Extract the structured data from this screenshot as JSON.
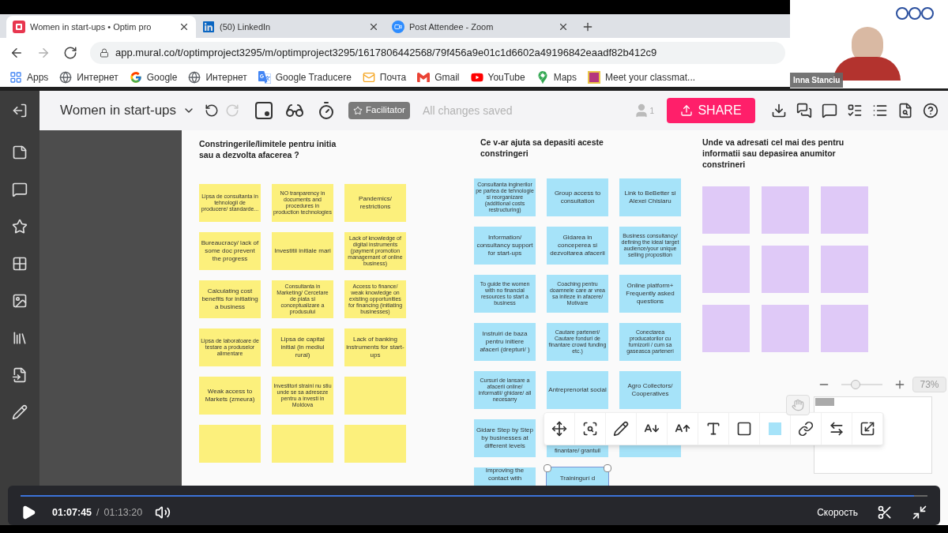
{
  "browser": {
    "tabs": [
      {
        "title": "Women in start-ups • Optim pro",
        "kind": "mural",
        "selected": true
      },
      {
        "title": "(50) LinkedIn",
        "kind": "linkedin",
        "selected": false
      },
      {
        "title": "Post Attendee - Zoom",
        "kind": "zoom",
        "selected": false
      }
    ],
    "nav": [
      {
        "kind": "back",
        "disabled": false
      },
      {
        "kind": "forward",
        "disabled": true
      },
      {
        "kind": "reload",
        "disabled": false
      }
    ],
    "url": "app.mural.co/t/optimproject3295/m/optimproject3295/1617806442568/79f456a9e01c1d6602a49196842eaadf82b412c9",
    "bookmarks": [
      {
        "label": "Apps",
        "kind": "apps"
      },
      {
        "label": "Интернет",
        "kind": "globe"
      },
      {
        "label": "Google",
        "kind": "google"
      },
      {
        "label": "Интернет",
        "kind": "globe"
      },
      {
        "label": "Google Traducere",
        "kind": "translate"
      },
      {
        "label": "Почта",
        "kind": "mail"
      },
      {
        "label": "Gmail",
        "kind": "gmail"
      },
      {
        "label": "YouTube",
        "kind": "youtube"
      },
      {
        "label": "Maps",
        "kind": "maps"
      },
      {
        "label": "Meet your classmat...",
        "kind": "square"
      }
    ]
  },
  "webcam": {
    "name": "Inna Stanciu"
  },
  "mural": {
    "title": "Women in start-ups",
    "history": [
      {
        "kind": "undo",
        "disabled": false
      },
      {
        "kind": "redo",
        "disabled": true
      }
    ],
    "facilitator": "Facilitator",
    "save_status": "All changes saved",
    "participants": "1",
    "share": "SHARE",
    "columns": [
      {
        "title": "Constringerile/limitele pentru initia sau a dezvolta afacerea ?",
        "color": "#fcf07c",
        "notes": [
          {
            "text": "Lipsa de consultanta in tehnologii de producere/ standarde...",
            "kind": "small",
            "selected": false
          },
          {
            "text": "NO tranparency in documents and procedures in production technologies",
            "kind": "small",
            "selected": false
          },
          {
            "text": "Pandemics/ restrictions",
            "kind": "normal",
            "selected": false
          },
          {
            "text": "Bureaucracy/ lack of some doc prevent the progress",
            "kind": "normal",
            "selected": false
          },
          {
            "text": "Investitii initiale mari",
            "kind": "normal",
            "selected": false
          },
          {
            "text": "Lack of knowledge of digital instruments (payment promotion managemant of online business)",
            "kind": "small",
            "selected": false
          },
          {
            "text": "Calculating cost benefits for initiating a business",
            "kind": "normal",
            "selected": false
          },
          {
            "text": "Consultanta in Marketing/ Cercetare de piata si conceptualizare a produsului",
            "kind": "small",
            "selected": false
          },
          {
            "text": "Access to finance/ weak knowledge on existing opportunities for financing (initiating businesses)",
            "kind": "small",
            "selected": false
          },
          {
            "text": "Lipsa de laboratoare de testare a produselor alimentare",
            "kind": "small",
            "selected": false
          },
          {
            "text": "Lipsa de capital initial (in mediul rural)",
            "kind": "normal",
            "selected": false
          },
          {
            "text": "Lack of banking instruments for start-ups",
            "kind": "normal",
            "selected": false
          },
          {
            "text": "Weak access to Markets (zmeura)",
            "kind": "normal",
            "selected": false
          },
          {
            "text": "Investitori straini nu stiu unde se sa adreseze pentru a investi in Moldova",
            "kind": "small",
            "selected": false
          },
          {
            "kind": "empty",
            "selected": false
          },
          {
            "kind": "empty",
            "selected": false
          },
          {
            "kind": "empty",
            "selected": false
          },
          {
            "kind": "empty",
            "selected": false
          }
        ]
      },
      {
        "title": "Ce v-ar ajuta sa depasiti aceste constringeri",
        "color": "#a6e3f9",
        "notes": [
          {
            "text": "Consultanta inginerilor pe partea de tehnologie si reorganizare (additional costs restructuring)",
            "kind": "small",
            "selected": false
          },
          {
            "text": "Group access to consultation",
            "kind": "normal",
            "selected": false
          },
          {
            "text": "Link to BeBetter si Alexei Chislaru",
            "kind": "normal",
            "selected": false
          },
          {
            "text": "Information/ consultancy support for start-ups",
            "kind": "normal",
            "selected": false
          },
          {
            "text": "Gidarea in conceperea si dezvoltarea afacerii",
            "kind": "normal",
            "selected": false
          },
          {
            "text": "Business consultancy/ defining the ideal target audience/your unique selling proposition",
            "kind": "small",
            "selected": false
          },
          {
            "text": "To guide the women with no financial resources to start a business",
            "kind": "small",
            "selected": false
          },
          {
            "text": "Coaching pentru doamnele care ar vrea sa initeze in afacere/ Motivare",
            "kind": "small",
            "selected": false
          },
          {
            "text": "Online platform+ Frequently asked questions",
            "kind": "normal",
            "selected": false
          },
          {
            "text": "Instruiri de baza pentru initiere afaceri (drepturi/ )",
            "kind": "normal",
            "selected": false
          },
          {
            "text": "Cautare parteneri/ Cautare fonduri de finantare crowd funding etc.)",
            "kind": "small",
            "selected": false
          },
          {
            "text": "Conectarea producatorilor cu furnizorii / cum sa gaseasca parteneri",
            "kind": "small",
            "selected": false
          },
          {
            "text": "Cursuri de lansare a afacerii online/ informatii/ ghidare/ all necesarry",
            "kind": "small",
            "selected": false
          },
          {
            "text": "Antreprenoriat social",
            "kind": "normal",
            "selected": false
          },
          {
            "text": "Agro Collectors/ Cooperatives",
            "kind": "normal",
            "selected": false
          },
          {
            "text": "Gidare Step by Step by businesses at different levels",
            "kind": "normal",
            "selected": false
          },
          {
            "text": "finantare/ grantuil",
            "kind": "bottom",
            "selected": false
          },
          {
            "kind": "empty",
            "selected": false
          },
          {
            "text": "Improving the contact with",
            "kind": "top",
            "selected": false
          },
          {
            "text": "Trainingurí d",
            "kind": "top",
            "selected": true
          }
        ]
      },
      {
        "title": "Unde va adresati cel mai des pentru informatii sau depasirea anumitor constrineri",
        "color": "#dfc9f7",
        "notes": [
          {
            "kind": "empty",
            "selected": false
          },
          {
            "kind": "empty",
            "selected": false
          },
          {
            "kind": "empty",
            "selected": false
          },
          {
            "kind": "empty",
            "selected": false
          },
          {
            "kind": "empty",
            "selected": false
          },
          {
            "kind": "empty",
            "selected": false
          },
          {
            "kind": "empty",
            "selected": false
          },
          {
            "kind": "empty",
            "selected": false
          },
          {
            "kind": "empty",
            "selected": false
          }
        ]
      }
    ],
    "zoom": {
      "reading": "73%",
      "level": 0.35
    }
  },
  "video": {
    "elapsed": "01:07:45",
    "separator": "/",
    "total": "01:13:20",
    "level": 0.985,
    "speed": "Скорость"
  }
}
